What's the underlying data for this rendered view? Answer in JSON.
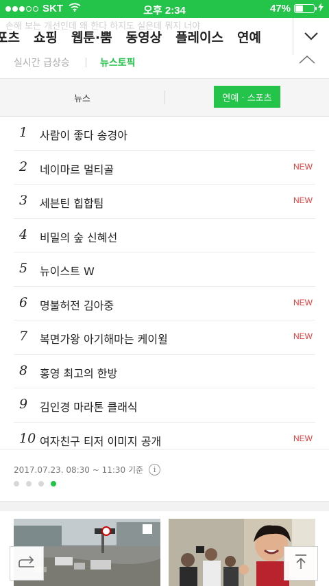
{
  "status_bar": {
    "carrier": "SKT",
    "time": "오후 2:34",
    "battery_percent": "47%",
    "battery_level": 0.47,
    "signal_bars_filled": 3,
    "signal_bars_total": 5
  },
  "nav": {
    "ghost_text": "손해 보는 개선인데 왜 한다 하지도 실은데 뭐지 너야",
    "items": [
      "포츠",
      "쇼핑",
      "웹툰·뿜",
      "동영상",
      "플레이스",
      "연예"
    ]
  },
  "sub_tabs": {
    "realtime": "실시간 급상승",
    "newstopic": "뉴스토픽"
  },
  "segment": {
    "news": "뉴스",
    "entertainment_sports": "연예 · 스포츠"
  },
  "ranking": [
    {
      "rank": "1",
      "title": "사람이 좋다 송경아",
      "new": ""
    },
    {
      "rank": "2",
      "title": "네이마르 멀티골",
      "new": "NEW"
    },
    {
      "rank": "3",
      "title": "세븐틴 힙합팀",
      "new": "NEW"
    },
    {
      "rank": "4",
      "title": "비밀의 숲 신혜선",
      "new": ""
    },
    {
      "rank": "5",
      "title": "뉴이스트 W",
      "new": ""
    },
    {
      "rank": "6",
      "title": "명불허전 김아중",
      "new": "NEW"
    },
    {
      "rank": "7",
      "title": "복면가왕 아기해마는 케이윌",
      "new": "NEW"
    },
    {
      "rank": "8",
      "title": "홍영 최고의 한방",
      "new": ""
    },
    {
      "rank": "9",
      "title": "김인경 마라톤 클래식",
      "new": ""
    },
    {
      "rank": "10",
      "title": "여자친구 티저 이미지 공개",
      "new": "NEW"
    }
  ],
  "timestamp": "2017.07.23. 08:30 ~ 11:30 기준",
  "info_icon_glyph": "i",
  "pagination": {
    "count": 4,
    "active_index": 3
  },
  "colors": {
    "accent": "#24c34a",
    "new_badge": "#e83c3c"
  },
  "icons": {
    "wifi": "wifi-icon",
    "battery": "battery-icon",
    "charging": "charging-bolt-icon",
    "expand": "chevron-down-icon",
    "collapse": "chevron-up-icon",
    "share": "share-arrow-icon",
    "scroll_top": "scroll-to-top-icon",
    "info": "info-icon"
  }
}
